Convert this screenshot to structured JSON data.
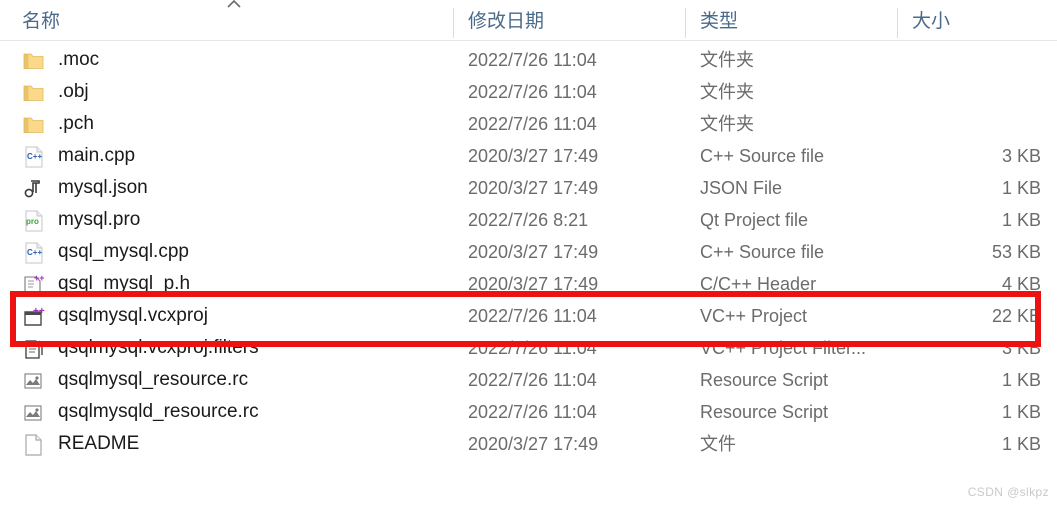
{
  "window": {
    "kind": "file-explorer-details-list",
    "watermark": "CSDN @slkpz"
  },
  "columns": {
    "name": {
      "label": "名称",
      "sorted": true,
      "sort_direction": "ascending",
      "sort_icon": "chevron-up-icon"
    },
    "date_modified": {
      "label": "修改日期"
    },
    "type": {
      "label": "类型"
    },
    "size": {
      "label": "大小"
    }
  },
  "highlight": {
    "color": "#ee1111",
    "target_row_index": 8,
    "target_row_name": "qsqlmysql.vcxproj"
  },
  "rows": [
    {
      "name": ".moc",
      "date_modified": "2022/7/26 11:04",
      "type": "文件夹",
      "size": "",
      "icon": "folder-icon"
    },
    {
      "name": ".obj",
      "date_modified": "2022/7/26 11:04",
      "type": "文件夹",
      "size": "",
      "icon": "folder-icon"
    },
    {
      "name": ".pch",
      "date_modified": "2022/7/26 11:04",
      "type": "文件夹",
      "size": "",
      "icon": "folder-icon"
    },
    {
      "name": "main.cpp",
      "date_modified": "2020/3/27 17:49",
      "type": "C++ Source file",
      "size": "3 KB",
      "icon": "cpp-source-file-icon"
    },
    {
      "name": "mysql.json",
      "date_modified": "2020/3/27 17:49",
      "type": "JSON File",
      "size": "1 KB",
      "icon": "json-file-icon"
    },
    {
      "name": "mysql.pro",
      "date_modified": "2022/7/26 8:21",
      "type": "Qt Project file",
      "size": "1 KB",
      "icon": "qt-project-file-icon"
    },
    {
      "name": "qsql_mysql.cpp",
      "date_modified": "2020/3/27 17:49",
      "type": "C++ Source file",
      "size": "53 KB",
      "icon": "cpp-source-file-icon"
    },
    {
      "name": "qsql_mysql_p.h",
      "date_modified": "2020/3/27 17:49",
      "type": "C/C++ Header",
      "size": "4 KB",
      "icon": "cpp-header-file-icon"
    },
    {
      "name": "qsqlmysql.vcxproj",
      "date_modified": "2022/7/26 11:04",
      "type": "VC++ Project",
      "size": "22 KB",
      "icon": "vcxproj-file-icon"
    },
    {
      "name": "qsqlmysql.vcxproj.filters",
      "date_modified": "2022/7/26 11:04",
      "type": "VC++ Project Filter...",
      "size": "3 KB",
      "icon": "vcxproj-filters-file-icon"
    },
    {
      "name": "qsqlmysql_resource.rc",
      "date_modified": "2022/7/26 11:04",
      "type": "Resource Script",
      "size": "1 KB",
      "icon": "resource-script-file-icon"
    },
    {
      "name": "qsqlmysqld_resource.rc",
      "date_modified": "2022/7/26 11:04",
      "type": "Resource Script",
      "size": "1 KB",
      "icon": "resource-script-file-icon"
    },
    {
      "name": "README",
      "date_modified": "2020/3/27 17:49",
      "type": "文件",
      "size": "1 KB",
      "icon": "generic-file-icon"
    }
  ]
}
